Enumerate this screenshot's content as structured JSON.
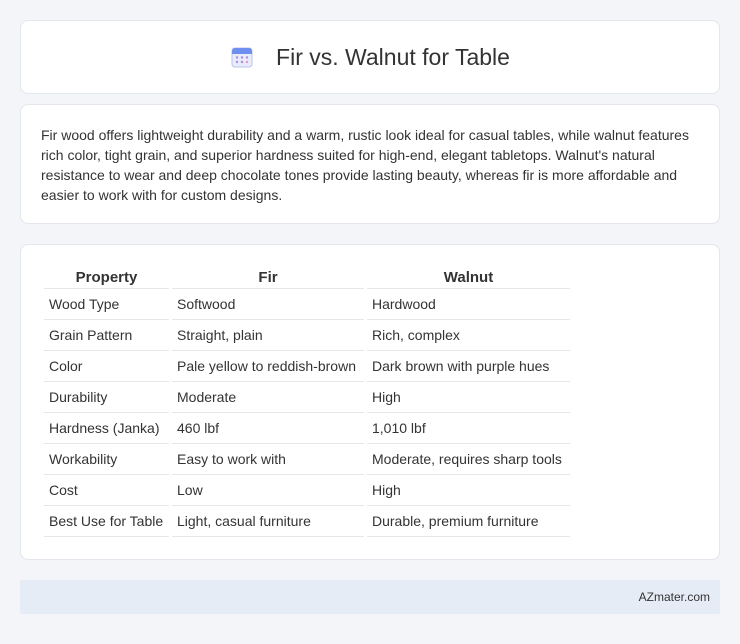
{
  "header": {
    "title": "Fir vs. Walnut for Table",
    "icon": "calendar-icon"
  },
  "intro": {
    "text": "Fir wood offers lightweight durability and a warm, rustic look ideal for casual tables, while walnut features rich color, tight grain, and superior hardness suited for high-end, elegant tabletops. Walnut's natural resistance to wear and deep chocolate tones provide lasting beauty, whereas fir is more affordable and easier to work with for custom designs."
  },
  "table": {
    "headers": [
      "Property",
      "Fir",
      "Walnut"
    ],
    "rows": [
      [
        "Wood Type",
        "Softwood",
        "Hardwood"
      ],
      [
        "Grain Pattern",
        "Straight, plain",
        "Rich, complex"
      ],
      [
        "Color",
        "Pale yellow to reddish-brown",
        "Dark brown with purple hues"
      ],
      [
        "Durability",
        "Moderate",
        "High"
      ],
      [
        "Hardness (Janka)",
        "460 lbf",
        "1,010 lbf"
      ],
      [
        "Workability",
        "Easy to work with",
        "Moderate, requires sharp tools"
      ],
      [
        "Cost",
        "Low",
        "High"
      ],
      [
        "Best Use for Table",
        "Light, casual furniture",
        "Durable, premium furniture"
      ]
    ]
  },
  "footer": {
    "text": "AZmater.com"
  }
}
